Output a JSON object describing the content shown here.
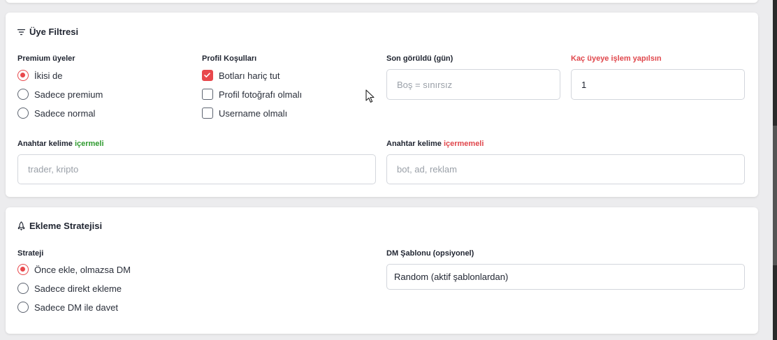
{
  "filter": {
    "title": "Üye Filtresi",
    "premium": {
      "label": "Premium üyeler",
      "options": [
        "İkisi de",
        "Sadece premium",
        "Sadece normal"
      ],
      "selected": "İkisi de"
    },
    "profile": {
      "label": "Profil Koşulları",
      "checks": [
        {
          "label": "Botları hariç tut",
          "checked": true
        },
        {
          "label": "Profil fotoğrafı olmalı",
          "checked": false
        },
        {
          "label": "Username olmalı",
          "checked": false
        }
      ]
    },
    "last_seen": {
      "label": "Son görüldü (gün)",
      "placeholder": "Boş = sınırsız",
      "value": ""
    },
    "count": {
      "label": "Kaç üyeye işlem yapılsın",
      "value": "1"
    },
    "include": {
      "label_prefix": "Anahtar kelime",
      "label_highlight": "içermeli",
      "placeholder": "trader, kripto"
    },
    "exclude": {
      "label_prefix": "Anahtar kelime",
      "label_highlight": "içermemeli",
      "placeholder": "bot, ad, reklam"
    }
  },
  "strategy": {
    "title": "Ekleme Stratejisi",
    "label": "Strateji",
    "options": [
      "Önce ekle, olmazsa DM",
      "Sadece direkt ekleme",
      "Sadece DM ile davet"
    ],
    "selected": "Önce ekle, olmazsa DM",
    "dm_template": {
      "label": "DM Şablonu (opsiyonel)",
      "value": "Random (aktif şablonlardan)"
    }
  },
  "colors": {
    "accent": "#e8484c",
    "include_green": "#2f9a2f",
    "exclude_red": "#e0474c"
  }
}
